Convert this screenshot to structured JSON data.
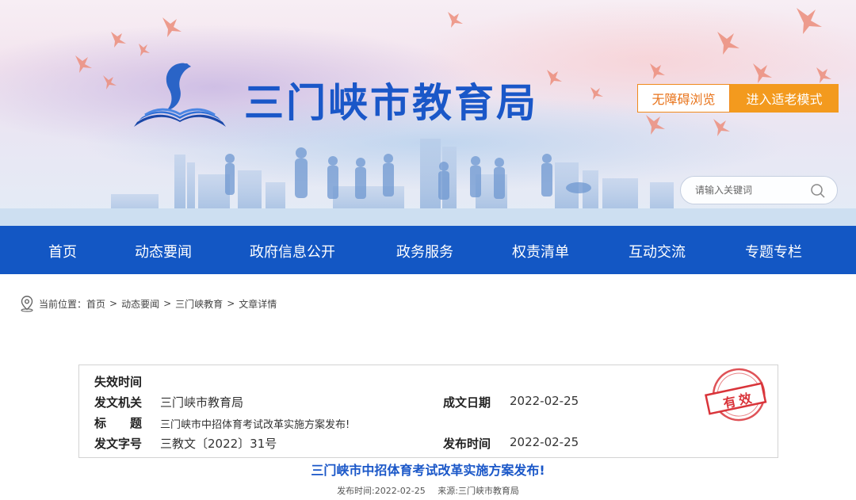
{
  "header": {
    "site_title": "三门峡市教育局",
    "accessibility_label": "无障碍浏览",
    "elder_mode_label": "进入适老模式",
    "search_placeholder": "请输入关键词"
  },
  "nav": {
    "items": [
      "首页",
      "动态要闻",
      "政府信息公开",
      "政务服务",
      "权责清单",
      "互动交流",
      "专题专栏"
    ]
  },
  "breadcrumb": {
    "prefix": "当前位置：",
    "items": [
      "首页",
      "动态要闻",
      "三门峡教育",
      "文章详情"
    ],
    "separator": ">"
  },
  "info": {
    "expiry_label": "失效时间",
    "expiry_value": "",
    "issuer_label": "发文机关",
    "issuer_value": "三门峡市教育局",
    "date_label": "成文日期",
    "date_value": "2022-02-25",
    "title_label": "标　　题",
    "title_value": "三门峡市中招体育考试改革实施方案发布!",
    "doc_no_label": "发文字号",
    "doc_no_value": "三教文〔2022〕31号",
    "publish_label": "发布时间",
    "publish_value": "2022-02-25",
    "stamp_text": "有效"
  },
  "article": {
    "title": "三门峡市中招体育考试改革实施方案发布!",
    "publish_time": "发布时间:2022-02-25",
    "source": "来源:三门峡市教育局"
  },
  "colors": {
    "brand_blue": "#1357c4",
    "title_blue": "#1a57c8",
    "orange": "#f39a1e",
    "stamp_red": "#d9343a"
  }
}
